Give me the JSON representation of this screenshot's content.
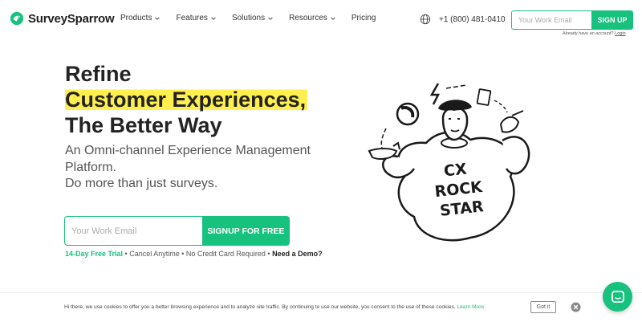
{
  "brand": {
    "name": "SurveySparrow",
    "accent": "#17c17e",
    "highlight": "#fff04f"
  },
  "nav": {
    "items": [
      {
        "label": "Products",
        "has_dropdown": true
      },
      {
        "label": "Features",
        "has_dropdown": true
      },
      {
        "label": "Solutions",
        "has_dropdown": true
      },
      {
        "label": "Resources",
        "has_dropdown": true
      },
      {
        "label": "Pricing",
        "has_dropdown": false
      }
    ],
    "phone": "+1 (800) 481-0410",
    "email_placeholder": "Your Work Email",
    "signup_label": "SIGN UP",
    "login_prompt": "Already have an account?",
    "login_link": "Login"
  },
  "hero": {
    "title_line1": "Refine",
    "title_line2": "Customer Experiences,",
    "title_line3": "The Better Way",
    "subtitle_line1": "An Omni-channel Experience Management",
    "subtitle_line2": "Platform.",
    "subtitle_line3": "Do more than just surveys.",
    "email_placeholder": "Your Work Email",
    "cta_label": "SIGNUP FOR FREE",
    "note_trial": "14-Day Free Trial",
    "note_rest": " • Cancel Anytime • No Credit Card Required • ",
    "note_demo": "Need a Demo?"
  },
  "illustration": {
    "cx": "CX",
    "rock": "ROCK",
    "star": "STAR"
  },
  "cookie": {
    "text": "Hi there, we use cookies to offer you a better browsing experience and to analyze site traffic. By continuing to use our website, you consent to the use of these cookies. ",
    "learn_more": "Learn More",
    "button": "Got it"
  }
}
